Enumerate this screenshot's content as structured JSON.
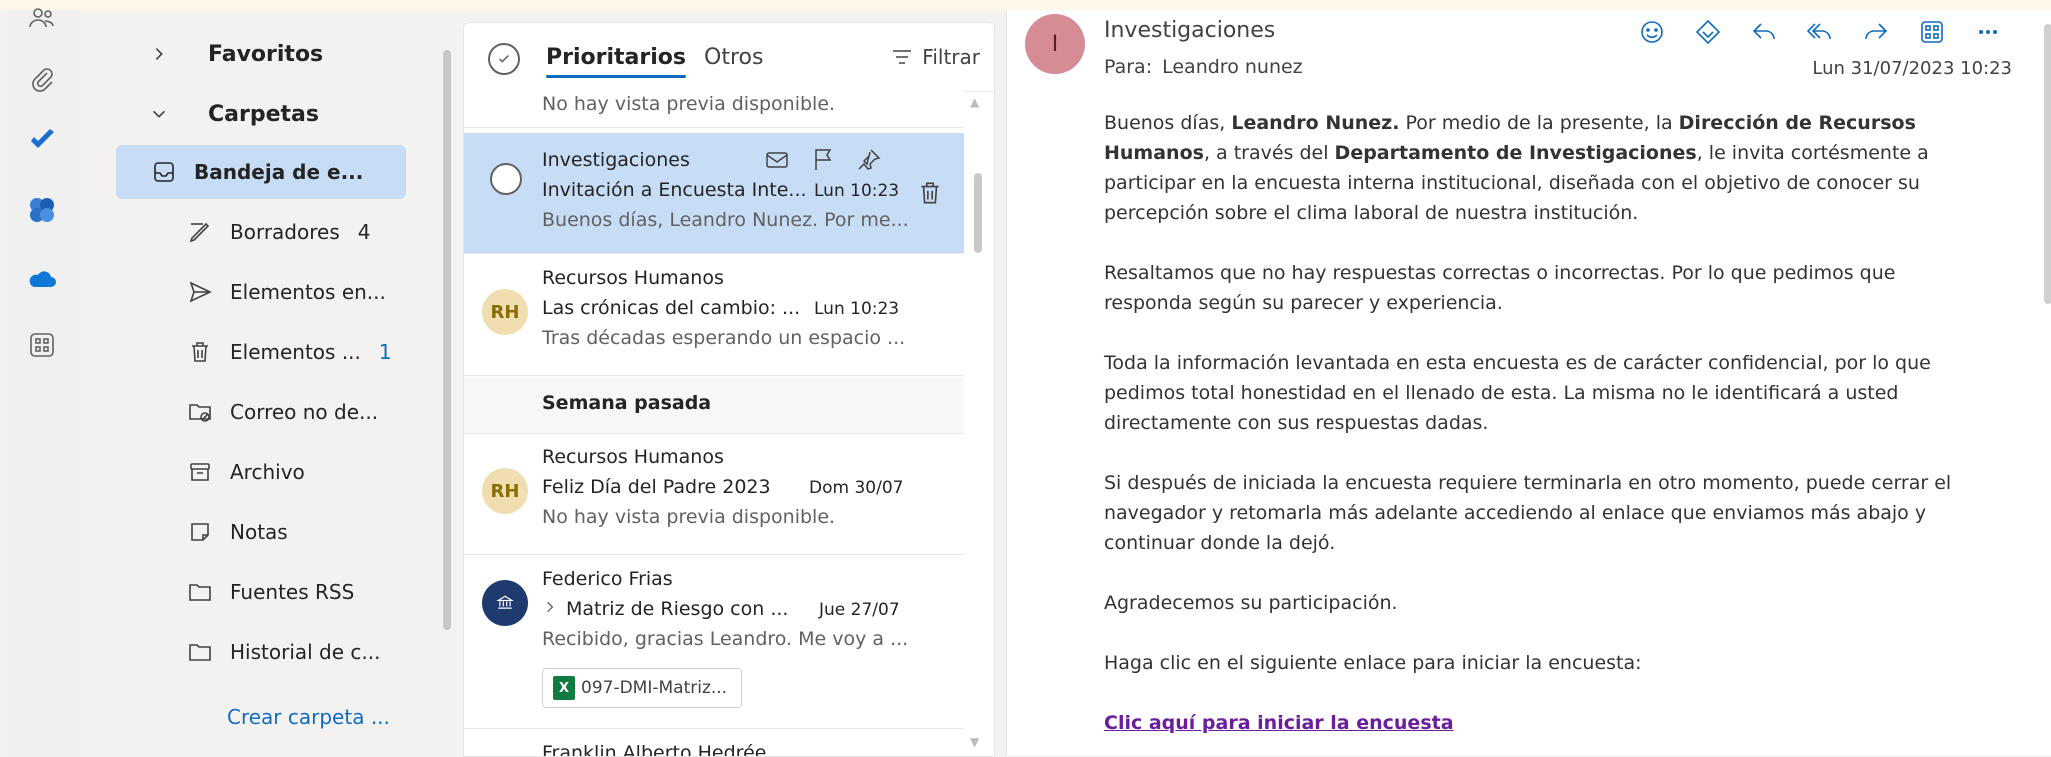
{
  "folders": {
    "group_favorites": "Favoritos",
    "group_folders": "Carpetas",
    "items": [
      {
        "label": "Bandeja de e...",
        "count": ""
      },
      {
        "label": "Borradores",
        "count": "4"
      },
      {
        "label": "Elementos en...",
        "count": ""
      },
      {
        "label": "Elementos ...",
        "count": "1"
      },
      {
        "label": "Correo no de...",
        "count": ""
      },
      {
        "label": "Archivo",
        "count": ""
      },
      {
        "label": "Notas",
        "count": ""
      },
      {
        "label": "Fuentes RSS",
        "count": ""
      },
      {
        "label": "Historial de c...",
        "count": ""
      }
    ],
    "create_folder": "Crear carpeta ..."
  },
  "list": {
    "tab_focused": "Prioritarios",
    "tab_other": "Otros",
    "filter": "Filtrar",
    "top_preview": "No hay vista previa disponible.",
    "section_last_week": "Semana pasada",
    "messages": [
      {
        "sender": "Investigaciones",
        "subject": "Invitación a Encuesta Inte...",
        "date": "Lun 10:23",
        "preview": "Buenos días, Leandro Nunez. Por me..."
      },
      {
        "initials": "RH",
        "sender": "Recursos Humanos",
        "subject": "Las crónicas del cambio: ...",
        "date": "Lun 10:23",
        "preview": "Tras décadas esperando un espacio ..."
      },
      {
        "initials": "RH",
        "sender": "Recursos Humanos",
        "subject": "Feliz Día del Padre 2023",
        "date": "Dom 30/07",
        "preview": "No hay vista previa disponible."
      },
      {
        "sender": "Federico Frias",
        "subject": "Matriz de Riesgo con ...",
        "date": "Jue 27/07",
        "preview": "Recibido, gracias Leandro. Me voy a ...",
        "attachment": "097-DMI-Matriz..."
      }
    ],
    "partial_sender": "Franklin Alberto Hedrée"
  },
  "reading": {
    "avatar_initial": "I",
    "from": "Investigaciones",
    "to_label": "Para:",
    "to_name": "Leandro nunez",
    "date": "Lun 31/07/2023 10:23",
    "greeting": "Buenos días, ",
    "name_bold": "Leandro Nunez.",
    "p1_a": " Por medio de la presente, la ",
    "dept1_bold": "Dirección de Recursos Humanos",
    "p1_b": ", a través del ",
    "dept2_bold": "Departamento de Investigaciones",
    "p1_c": ", le invita cortésmente a participar en la encuesta interna institucional, diseñada con el objetivo de conocer su percepción sobre el clima laboral de nuestra institución.",
    "p2": "Resaltamos que no hay respuestas correctas o incorrectas. Por lo que pedimos que responda según su parecer y experiencia.",
    "p3": "Toda la información levantada en esta encuesta es de carácter confidencial, por lo que pedimos total honestidad en el llenado de esta. La misma no le identificará a usted directamente con sus respuestas dadas.",
    "p4": "Si después de iniciada la encuesta requiere terminarla en otro momento, puede cerrar el navegador y retomarla más adelante accediendo al enlace que enviamos más abajo y continuar donde la dejó.",
    "p5": "Agradecemos su participación.",
    "p6": "Haga clic en el siguiente enlace para iniciar la encuesta:",
    "link": "Clic aquí para iniciar la encuesta"
  },
  "colors": {
    "accent": "#0f6cbd",
    "selected_bg": "#c7dcf5",
    "link": "#6c1d9c"
  }
}
